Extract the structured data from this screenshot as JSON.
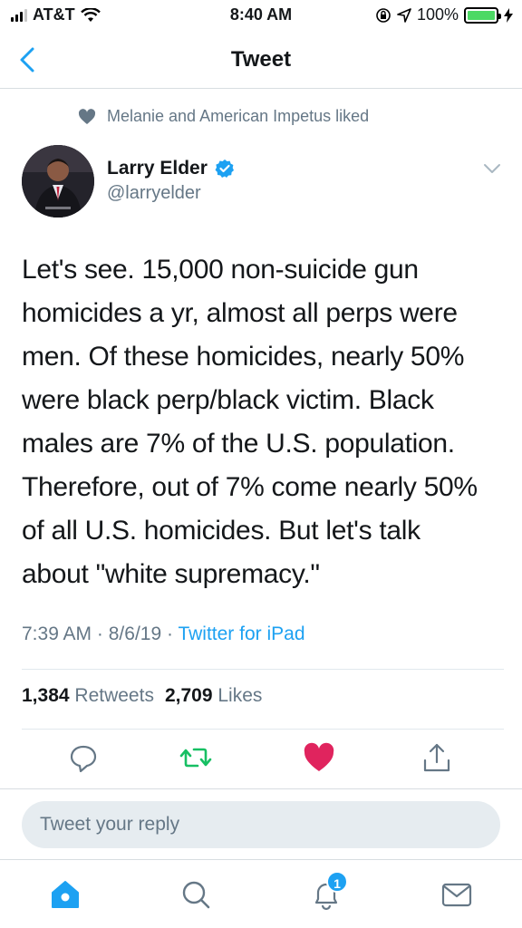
{
  "status_bar": {
    "carrier": "AT&T",
    "time": "8:40 AM",
    "battery_pct": "100%",
    "battery_level": 1.0
  },
  "nav": {
    "title": "Tweet",
    "back_icon": "chevron-left-icon"
  },
  "social_context": {
    "icon": "heart-icon",
    "text": "Melanie and American Impetus liked"
  },
  "author": {
    "name": "Larry Elder",
    "handle": "@larryelder",
    "verified_icon": "verified-badge-icon"
  },
  "tweet": {
    "text": "Let's see. 15,000 non-suicide gun\nhomicides a yr, almost all perps were\nmen. Of these homicides, nearly 50%\nwere black perp/black victim. Black\nmales are 7% of the U.S. population.\nTherefore, out of 7% come nearly 50%\nof all U.S. homicides. But let's talk\nabout \"white supremacy.\"",
    "time": "7:39 AM",
    "date": "8/6/19",
    "separator": "·",
    "source": "Twitter for iPad"
  },
  "stats": {
    "retweets_count": "1,384",
    "retweets_label": "Retweets",
    "likes_count": "2,709",
    "likes_label": "Likes"
  },
  "actions": {
    "reply_icon": "reply-icon",
    "retweet_icon": "retweet-icon",
    "like_icon": "heart-filled-icon",
    "share_icon": "share-icon",
    "retweet_color": "#17bf63",
    "like_color": "#e0245e"
  },
  "reply_bar": {
    "placeholder": "Tweet your reply"
  },
  "tab_bar": {
    "notifications_badge": "1",
    "accent": "#1da1f2"
  }
}
